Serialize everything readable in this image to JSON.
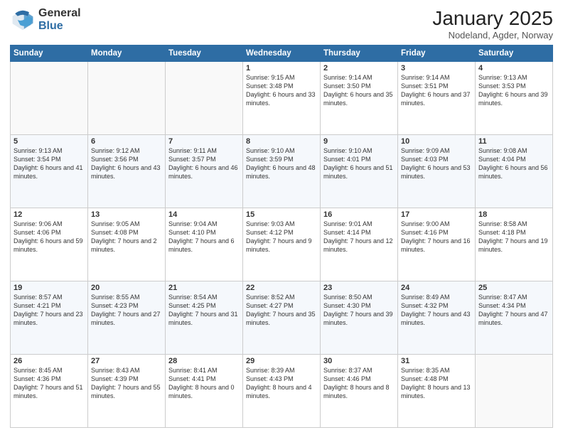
{
  "logo": {
    "general": "General",
    "blue": "Blue"
  },
  "header": {
    "month": "January 2025",
    "location": "Nodeland, Agder, Norway"
  },
  "weekdays": [
    "Sunday",
    "Monday",
    "Tuesday",
    "Wednesday",
    "Thursday",
    "Friday",
    "Saturday"
  ],
  "weeks": [
    [
      {
        "day": "",
        "info": ""
      },
      {
        "day": "",
        "info": ""
      },
      {
        "day": "",
        "info": ""
      },
      {
        "day": "1",
        "info": "Sunrise: 9:15 AM\nSunset: 3:48 PM\nDaylight: 6 hours and 33 minutes."
      },
      {
        "day": "2",
        "info": "Sunrise: 9:14 AM\nSunset: 3:50 PM\nDaylight: 6 hours and 35 minutes."
      },
      {
        "day": "3",
        "info": "Sunrise: 9:14 AM\nSunset: 3:51 PM\nDaylight: 6 hours and 37 minutes."
      },
      {
        "day": "4",
        "info": "Sunrise: 9:13 AM\nSunset: 3:53 PM\nDaylight: 6 hours and 39 minutes."
      }
    ],
    [
      {
        "day": "5",
        "info": "Sunrise: 9:13 AM\nSunset: 3:54 PM\nDaylight: 6 hours and 41 minutes."
      },
      {
        "day": "6",
        "info": "Sunrise: 9:12 AM\nSunset: 3:56 PM\nDaylight: 6 hours and 43 minutes."
      },
      {
        "day": "7",
        "info": "Sunrise: 9:11 AM\nSunset: 3:57 PM\nDaylight: 6 hours and 46 minutes."
      },
      {
        "day": "8",
        "info": "Sunrise: 9:10 AM\nSunset: 3:59 PM\nDaylight: 6 hours and 48 minutes."
      },
      {
        "day": "9",
        "info": "Sunrise: 9:10 AM\nSunset: 4:01 PM\nDaylight: 6 hours and 51 minutes."
      },
      {
        "day": "10",
        "info": "Sunrise: 9:09 AM\nSunset: 4:03 PM\nDaylight: 6 hours and 53 minutes."
      },
      {
        "day": "11",
        "info": "Sunrise: 9:08 AM\nSunset: 4:04 PM\nDaylight: 6 hours and 56 minutes."
      }
    ],
    [
      {
        "day": "12",
        "info": "Sunrise: 9:06 AM\nSunset: 4:06 PM\nDaylight: 6 hours and 59 minutes."
      },
      {
        "day": "13",
        "info": "Sunrise: 9:05 AM\nSunset: 4:08 PM\nDaylight: 7 hours and 2 minutes."
      },
      {
        "day": "14",
        "info": "Sunrise: 9:04 AM\nSunset: 4:10 PM\nDaylight: 7 hours and 6 minutes."
      },
      {
        "day": "15",
        "info": "Sunrise: 9:03 AM\nSunset: 4:12 PM\nDaylight: 7 hours and 9 minutes."
      },
      {
        "day": "16",
        "info": "Sunrise: 9:01 AM\nSunset: 4:14 PM\nDaylight: 7 hours and 12 minutes."
      },
      {
        "day": "17",
        "info": "Sunrise: 9:00 AM\nSunset: 4:16 PM\nDaylight: 7 hours and 16 minutes."
      },
      {
        "day": "18",
        "info": "Sunrise: 8:58 AM\nSunset: 4:18 PM\nDaylight: 7 hours and 19 minutes."
      }
    ],
    [
      {
        "day": "19",
        "info": "Sunrise: 8:57 AM\nSunset: 4:21 PM\nDaylight: 7 hours and 23 minutes."
      },
      {
        "day": "20",
        "info": "Sunrise: 8:55 AM\nSunset: 4:23 PM\nDaylight: 7 hours and 27 minutes."
      },
      {
        "day": "21",
        "info": "Sunrise: 8:54 AM\nSunset: 4:25 PM\nDaylight: 7 hours and 31 minutes."
      },
      {
        "day": "22",
        "info": "Sunrise: 8:52 AM\nSunset: 4:27 PM\nDaylight: 7 hours and 35 minutes."
      },
      {
        "day": "23",
        "info": "Sunrise: 8:50 AM\nSunset: 4:30 PM\nDaylight: 7 hours and 39 minutes."
      },
      {
        "day": "24",
        "info": "Sunrise: 8:49 AM\nSunset: 4:32 PM\nDaylight: 7 hours and 43 minutes."
      },
      {
        "day": "25",
        "info": "Sunrise: 8:47 AM\nSunset: 4:34 PM\nDaylight: 7 hours and 47 minutes."
      }
    ],
    [
      {
        "day": "26",
        "info": "Sunrise: 8:45 AM\nSunset: 4:36 PM\nDaylight: 7 hours and 51 minutes."
      },
      {
        "day": "27",
        "info": "Sunrise: 8:43 AM\nSunset: 4:39 PM\nDaylight: 7 hours and 55 minutes."
      },
      {
        "day": "28",
        "info": "Sunrise: 8:41 AM\nSunset: 4:41 PM\nDaylight: 8 hours and 0 minutes."
      },
      {
        "day": "29",
        "info": "Sunrise: 8:39 AM\nSunset: 4:43 PM\nDaylight: 8 hours and 4 minutes."
      },
      {
        "day": "30",
        "info": "Sunrise: 8:37 AM\nSunset: 4:46 PM\nDaylight: 8 hours and 8 minutes."
      },
      {
        "day": "31",
        "info": "Sunrise: 8:35 AM\nSunset: 4:48 PM\nDaylight: 8 hours and 13 minutes."
      },
      {
        "day": "",
        "info": ""
      }
    ]
  ]
}
